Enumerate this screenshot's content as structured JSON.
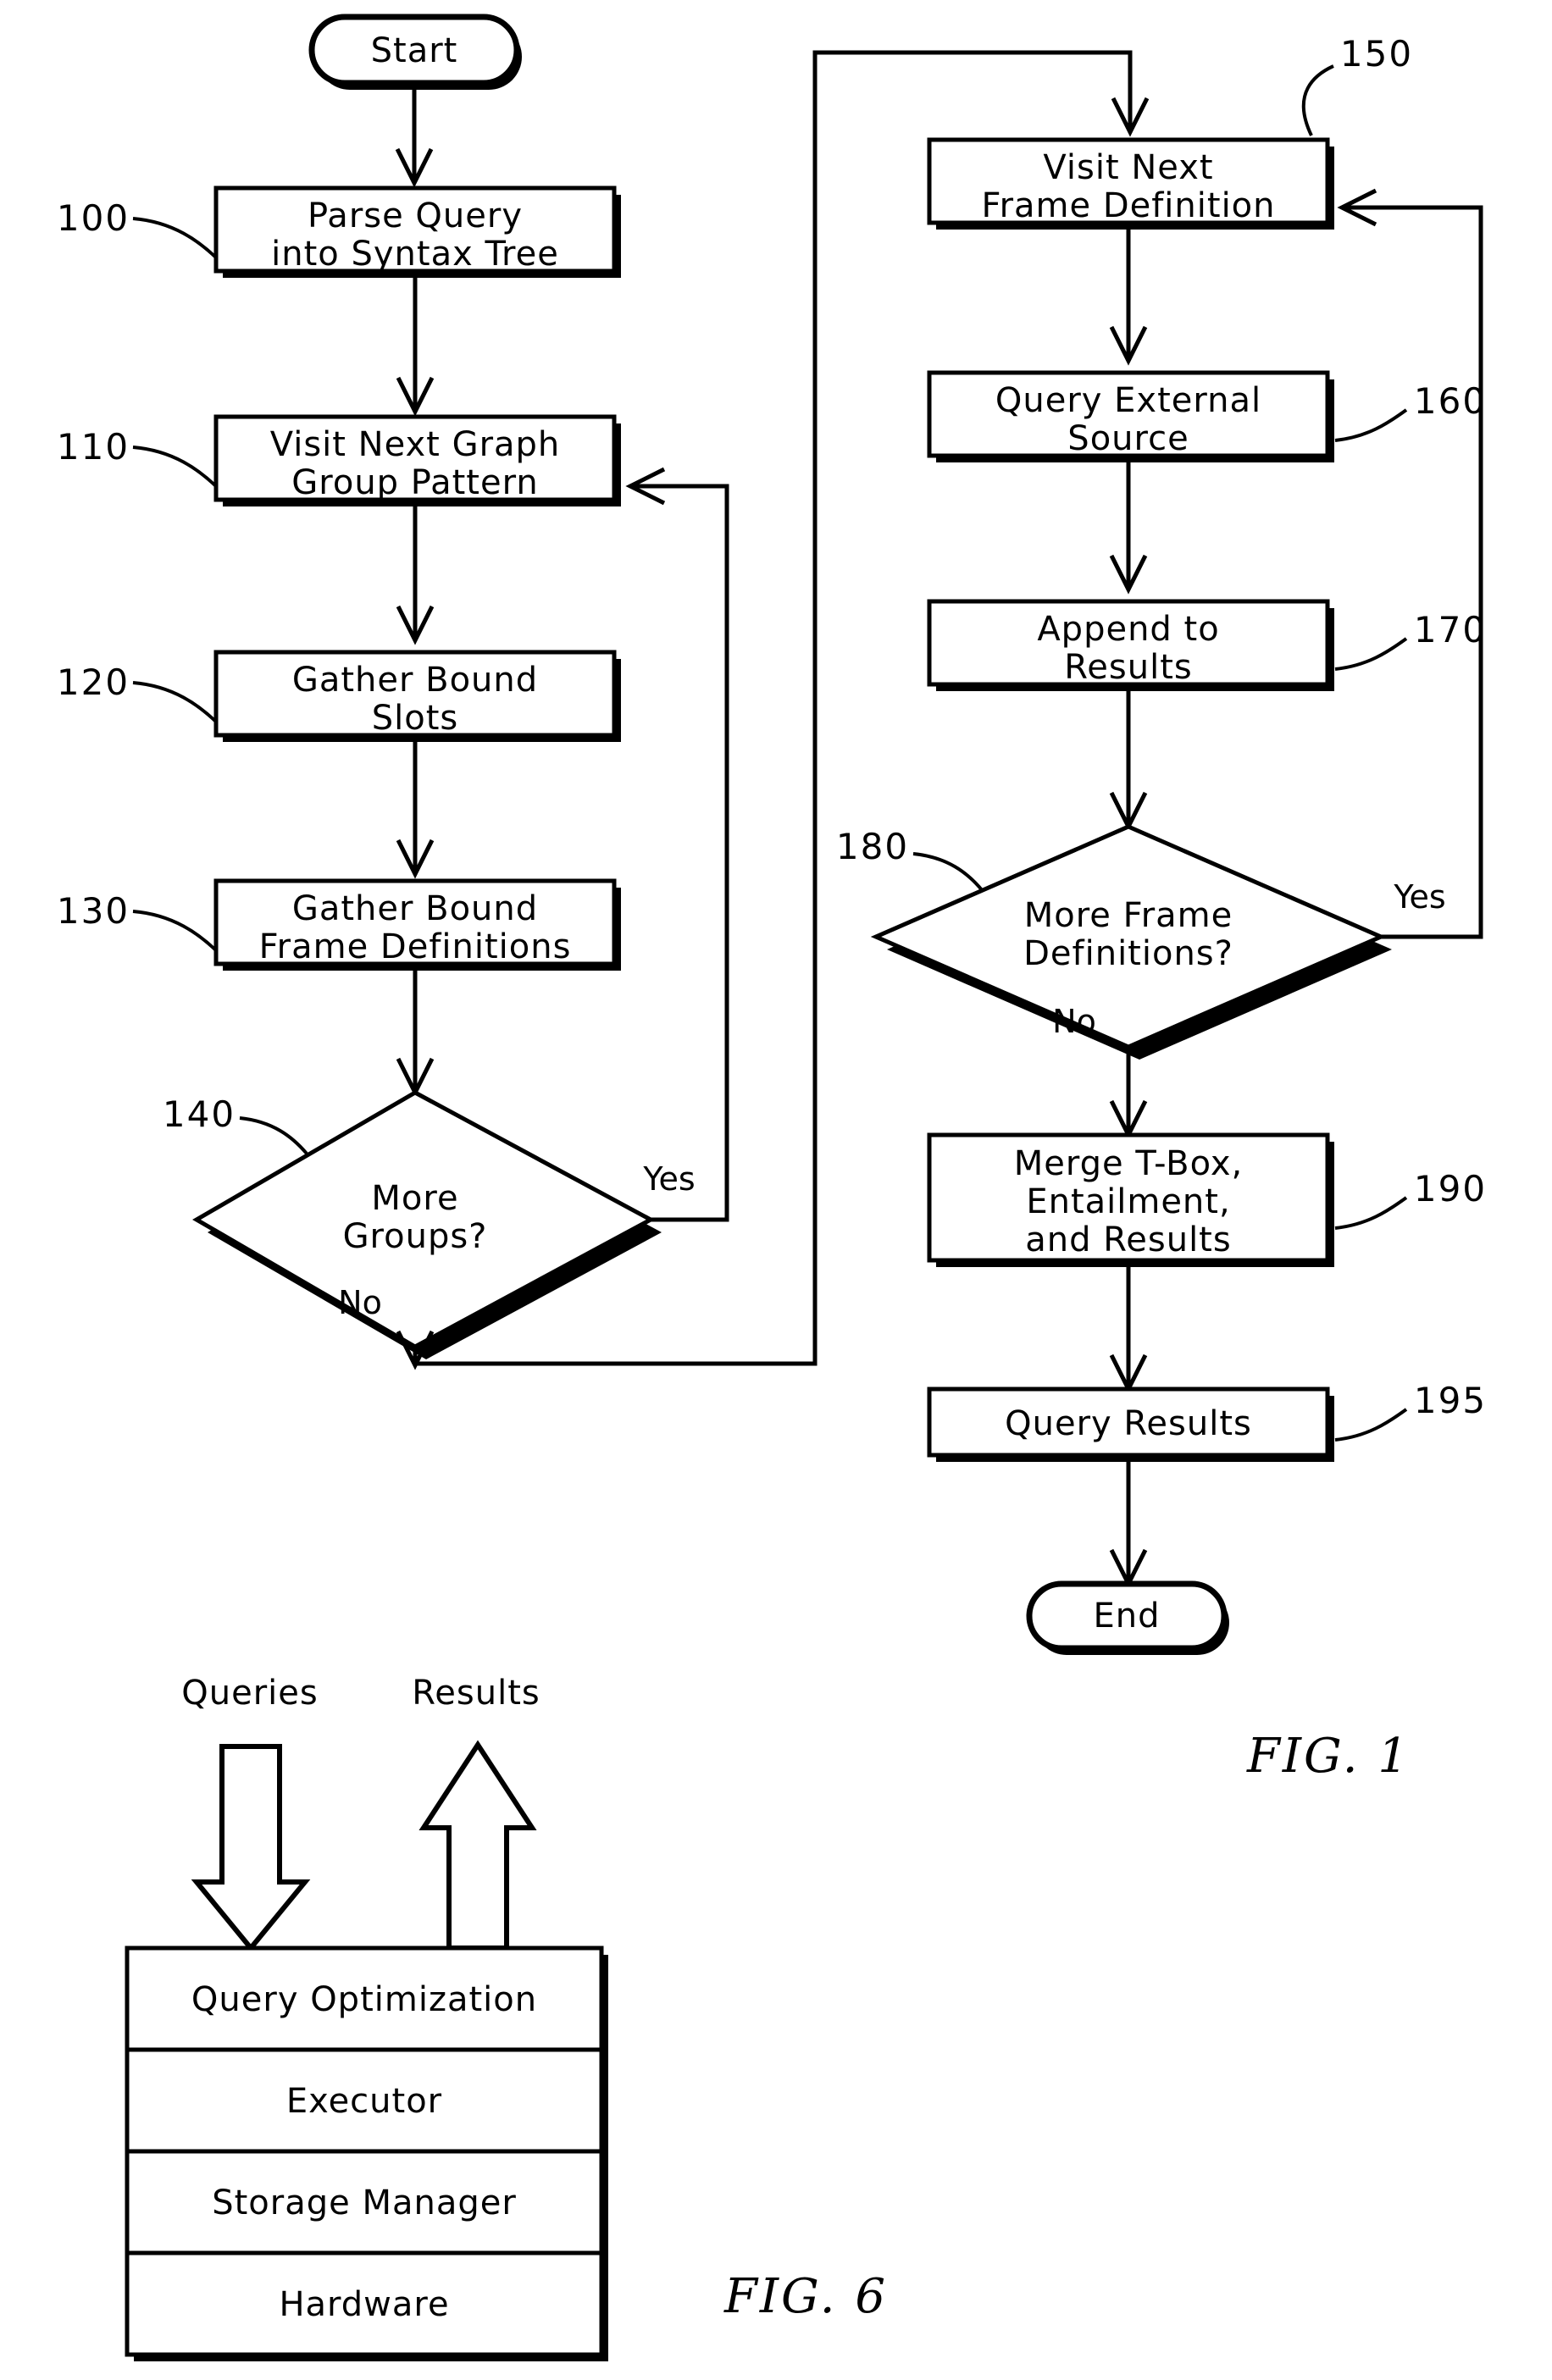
{
  "figures": [
    {
      "id": "fig-1",
      "label": "FIG.  1",
      "type": "flowchart",
      "terminals": {
        "start": "Start",
        "end": "End"
      },
      "nodes": [
        {
          "ref": "100",
          "kind": "process",
          "lines": [
            "Parse  Query",
            "into  Syntax  Tree"
          ]
        },
        {
          "ref": "110",
          "kind": "process",
          "lines": [
            "Visit  Next  Graph",
            "Group  Pattern"
          ]
        },
        {
          "ref": "120",
          "kind": "process",
          "lines": [
            "Gather  Bound",
            "Slots"
          ]
        },
        {
          "ref": "130",
          "kind": "process",
          "lines": [
            "Gather  Bound",
            "Frame  Definitions"
          ]
        },
        {
          "ref": "140",
          "kind": "decision",
          "lines": [
            "More",
            "Groups?"
          ]
        },
        {
          "ref": "150",
          "kind": "process",
          "lines": [
            "Visit  Next",
            "Frame  Definition"
          ]
        },
        {
          "ref": "160",
          "kind": "process",
          "lines": [
            "Query  External",
            "Source"
          ]
        },
        {
          "ref": "170",
          "kind": "process",
          "lines": [
            "Append  to",
            "Results"
          ]
        },
        {
          "ref": "180",
          "kind": "decision",
          "lines": [
            "More  Frame",
            "Definitions?"
          ]
        },
        {
          "ref": "190",
          "kind": "process",
          "lines": [
            "Merge  T-Box,",
            "Entailment,",
            "and  Results"
          ]
        },
        {
          "ref": "195",
          "kind": "process",
          "lines": [
            "Query  Results"
          ]
        }
      ],
      "edge_labels": {
        "d140_yes": "Yes",
        "d140_no": "No",
        "d180_yes": "Yes",
        "d180_no": "No"
      }
    },
    {
      "id": "fig-6",
      "label": "FIG.  6",
      "type": "layer-stack",
      "io": {
        "input": "Queries",
        "output": "Results"
      },
      "layers": [
        "Query  Optimization",
        "Executor",
        "Storage  Manager",
        "Hardware"
      ]
    }
  ],
  "colors": {
    "ink": "#000000",
    "paper": "#ffffff"
  }
}
